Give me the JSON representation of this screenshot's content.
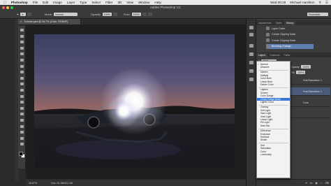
{
  "menubar": {
    "apple": "",
    "items": [
      "Photoshop",
      "File",
      "Edit",
      "Image",
      "Layer",
      "Type",
      "Select",
      "Filter",
      "3D",
      "View",
      "Window",
      "Help"
    ],
    "clock": "Wed 00:28",
    "user": "Michael Hamilton"
  },
  "app": {
    "title": "Adobe Photoshop CC",
    "workspace": "Essentials"
  },
  "options": {
    "mode_label": "Mode:",
    "mode_value": "Normal",
    "opacity_label": "Opacity:",
    "opacity_value": "100%",
    "flow_label": "Flow:",
    "flow_value": "100%"
  },
  "document": {
    "tab_title": "Tutorial.psd @ 16.7% (Core, RGB/8*)"
  },
  "status": {
    "zoom": "16.67%",
    "doc_info": "Doc: 51.3M/111.1M"
  },
  "history": {
    "tabs": [
      "Adjustments",
      "Styles",
      "History"
    ],
    "items": [
      "Layer Order",
      "Create Clipping Mask",
      "Create Clipping Mask",
      "Blending Change"
    ]
  },
  "layers": {
    "tabs": [
      "Layers",
      "Channels",
      "Paths"
    ],
    "kind_label": "Kind",
    "opacity_label": "Opacity:",
    "opacity_value": "100%",
    "fill_label": "Fill:",
    "fill_value": "100%",
    "rows": [
      {
        "name": "Hue/Saturation 1",
        "thumb": "white"
      },
      {
        "name": "Hue/Saturation 1",
        "thumb": "white"
      },
      {
        "name": "Core",
        "thumb": "dark"
      },
      {
        "name": "",
        "thumb": "dark"
      }
    ]
  },
  "blend_menu": {
    "groups": [
      [
        "Normal",
        "Dissolve"
      ],
      [
        "Darken",
        "Multiply",
        "Color Burn",
        "Linear Burn",
        "Darker Color"
      ],
      [
        "Lighten",
        "Screen",
        "Color Dodge",
        "Linear Dodge (Add)",
        "Lighter Color"
      ],
      [
        "Overlay",
        "Soft Light",
        "Hard Light",
        "Vivid Light",
        "Linear Light",
        "Pin Light",
        "Hard Mix"
      ],
      [
        "Difference",
        "Exclusion",
        "Subtract",
        "Divide"
      ],
      [
        "Hue",
        "Saturation",
        "Color",
        "Luminosity"
      ]
    ],
    "selected": "Linear Dodge (Add)",
    "checked": "Normal"
  },
  "colors": {
    "accent": "#3877d6",
    "history_selected": "#5f7fb0"
  }
}
